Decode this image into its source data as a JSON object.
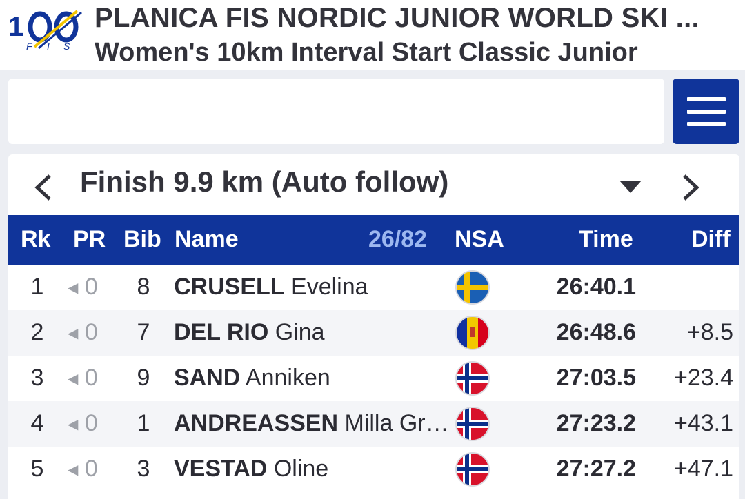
{
  "header": {
    "title": "PLANICA FIS NORDIC JUNIOR WORLD SKI ...",
    "subtitle": "Women's 10km Interval Start Classic Junior",
    "logo_text": "100 FIS"
  },
  "search": {
    "value": "",
    "placeholder": ""
  },
  "split": {
    "label": "Finish 9.9 km (Auto follow)",
    "prev_icon": "chevron-left-icon",
    "next_icon": "chevron-right-icon",
    "dropdown_icon": "caret-down-icon"
  },
  "table": {
    "columns": {
      "rank": "Rk",
      "pr": "PR",
      "bib": "Bib",
      "name": "Name",
      "count": "26/82",
      "nsa": "NSA",
      "time": "Time",
      "diff": "Diff"
    },
    "rows": [
      {
        "rank": "1",
        "pr": "0",
        "bib": "8",
        "last": "CRUSELL",
        "first": "Evelina",
        "nsa": "SWE",
        "time": "26:40.1",
        "diff": ""
      },
      {
        "rank": "2",
        "pr": "0",
        "bib": "7",
        "last": "DEL RIO",
        "first": "Gina",
        "nsa": "AND",
        "time": "26:48.6",
        "diff": "+8.5"
      },
      {
        "rank": "3",
        "pr": "0",
        "bib": "9",
        "last": "SAND",
        "first": "Anniken",
        "nsa": "NOR",
        "time": "27:03.5",
        "diff": "+23.4"
      },
      {
        "rank": "4",
        "pr": "0",
        "bib": "1",
        "last": "ANDREASSEN",
        "first": "Milla Gr…",
        "nsa": "NOR",
        "time": "27:23.2",
        "diff": "+43.1"
      },
      {
        "rank": "5",
        "pr": "0",
        "bib": "3",
        "last": "VESTAD",
        "first": "Oline",
        "nsa": "NOR",
        "time": "27:27.2",
        "diff": "+47.1"
      }
    ]
  },
  "colors": {
    "brand_blue": "#10349a",
    "count_blue": "#9db8f0",
    "muted": "#9ea1a8"
  }
}
